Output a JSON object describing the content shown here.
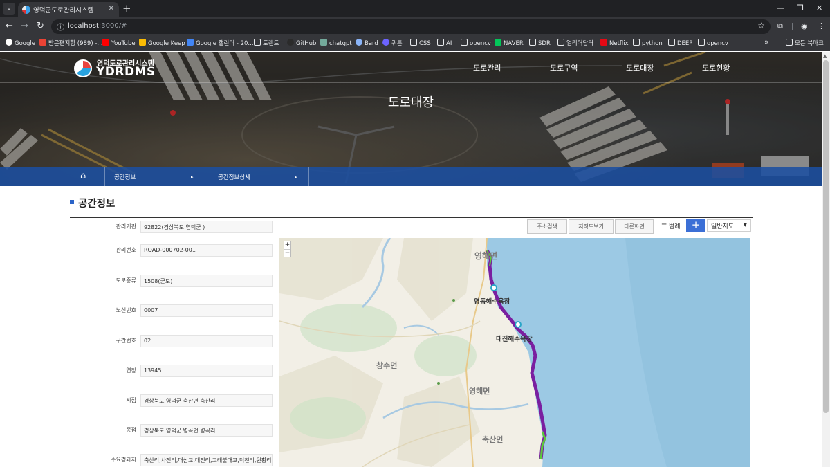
{
  "browser": {
    "tab_title": "영덕군도로관리시스템",
    "url_host": "localhost",
    "url_rest": ":3000/#",
    "bookmarks": [
      {
        "label": "Google",
        "color": "#ffffff"
      },
      {
        "label": "받은편지함 (989) -...",
        "color": "#ea4335"
      },
      {
        "label": "YouTube",
        "color": "#ff0000"
      },
      {
        "label": "Google Keep",
        "color": "#fbbc04"
      },
      {
        "label": "Google 캘린더 - 20...",
        "color": "#4285f4"
      },
      {
        "label": "토렌트",
        "color": "folder"
      },
      {
        "label": "GitHub",
        "color": "#2b2b2b"
      },
      {
        "label": "chatgpt",
        "color": "#74aa9c"
      },
      {
        "label": "Bard",
        "color": "#8ab4f8"
      },
      {
        "label": "퀴튼",
        "color": "#6c63ff"
      },
      {
        "label": "CSS",
        "color": "folder"
      },
      {
        "label": "AI",
        "color": "folder"
      },
      {
        "label": "opencv",
        "color": "folder"
      },
      {
        "label": "NAVER",
        "color": "#03c75a"
      },
      {
        "label": "SDR",
        "color": "folder"
      },
      {
        "label": "얼리어답터",
        "color": "folder"
      },
      {
        "label": "Netflix",
        "color": "#e50914"
      },
      {
        "label": "python",
        "color": "folder"
      },
      {
        "label": "DEEP",
        "color": "folder"
      },
      {
        "label": "opencv",
        "color": "folder"
      }
    ],
    "bookmarks_overflow": "»",
    "all_bookmarks": "모든 북마크"
  },
  "site": {
    "logo_kr": "영덕도로관리시스템",
    "logo_en": "YDRDMS",
    "nav": [
      "도로관리",
      "도로구역",
      "도로대장",
      "도로현황"
    ],
    "hero_title": "도로대장",
    "breadcrumb": [
      "공간정보",
      "공간정보상세"
    ]
  },
  "section_title": "공간정보",
  "fields": [
    {
      "label": "관리기관",
      "value": "92822(경상북도 영덕군 )"
    },
    {
      "label": "관리번호",
      "value": "ROAD-000702-001"
    },
    {
      "label": "도로종류",
      "value": "1508(군도)"
    },
    {
      "label": "노선번호",
      "value": "0007"
    },
    {
      "label": "구간번호",
      "value": "02"
    },
    {
      "label": "연장",
      "value": "13945"
    },
    {
      "label": "시점",
      "value": "경상북도 영덕군 축산면 축산리"
    },
    {
      "label": "종점",
      "value": "경상북도 영덕군 병곡면 병곡리"
    },
    {
      "label": "주요경과지",
      "value": "축산리,사진리,대심교,대진리,고래불대교,덕천리,원황리,고래"
    }
  ],
  "map_toolbar": {
    "address_search": "주소검색",
    "cadastral_view": "지적도보기",
    "other_screen": "다른화면",
    "legend": "범례",
    "add": "+",
    "map_type": "일반지도"
  },
  "map": {
    "zoom_in": "+",
    "zoom_out": "−",
    "labels": [
      "영해면",
      "영동해수욕장",
      "대진해수욕장",
      "창수면",
      "영해면",
      "축산면"
    ],
    "route_color": "#7a1fa0",
    "route_highlight": "#5cc93b"
  },
  "colors": {
    "accent": "#2b64c8",
    "crumb_bg": "#1b4fa0",
    "sea": "#9cc9e4"
  }
}
